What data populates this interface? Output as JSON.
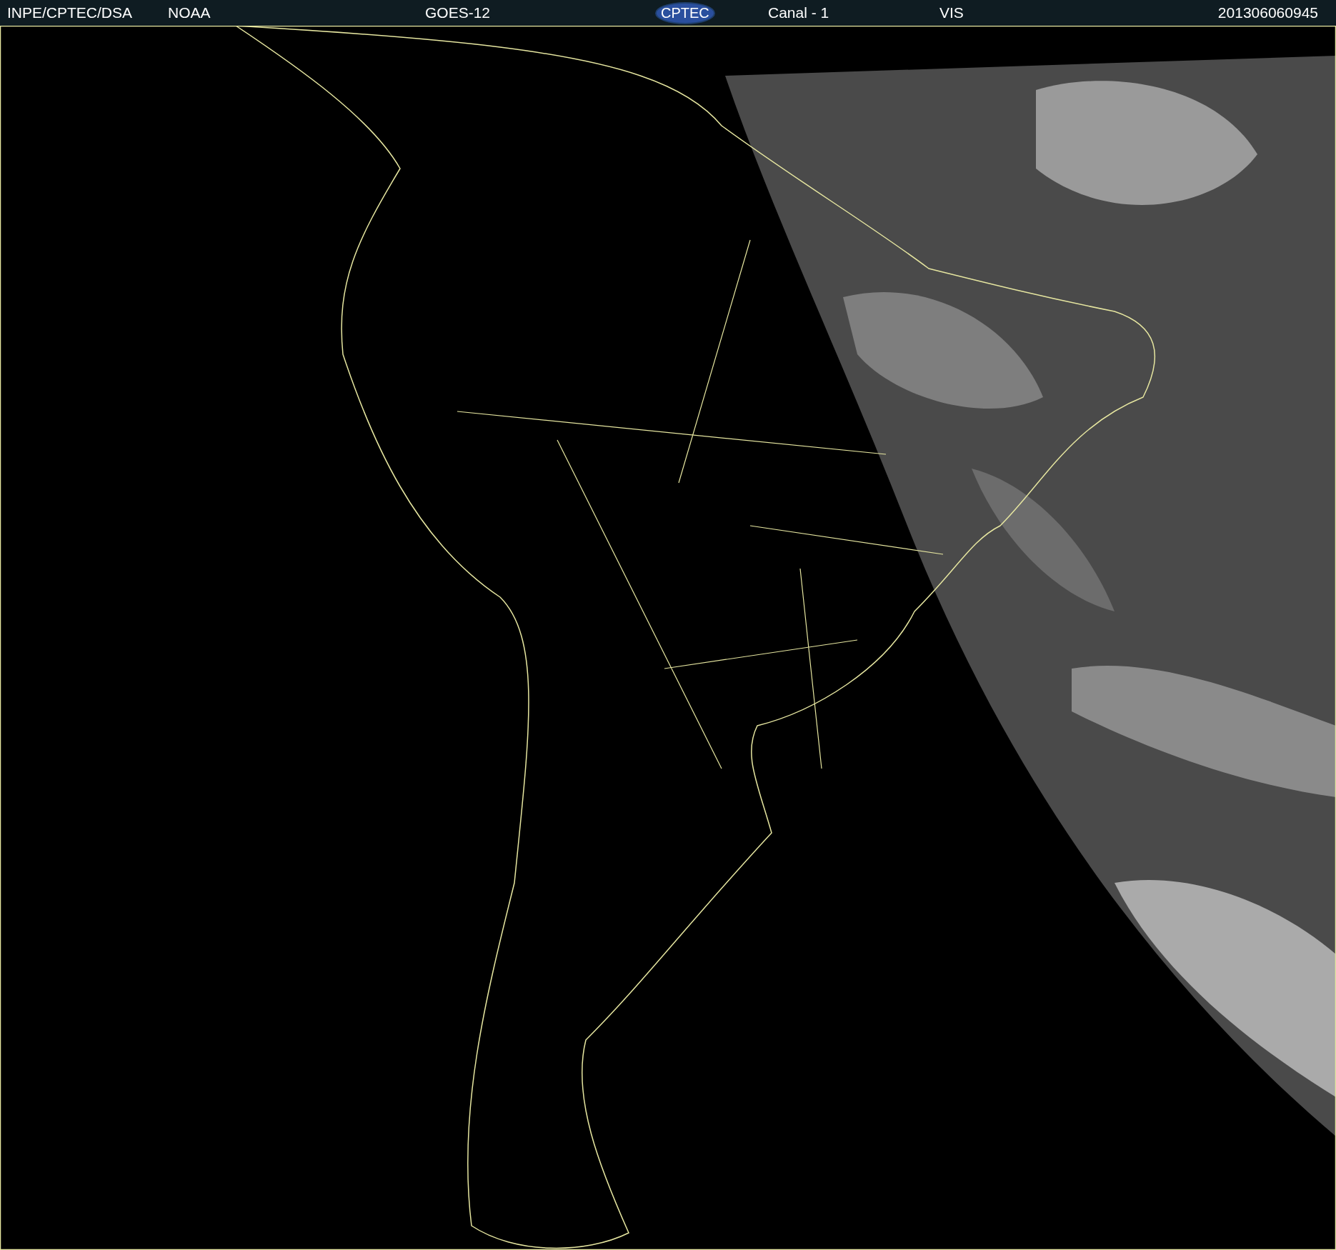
{
  "header": {
    "items": [
      {
        "kind": "text",
        "text": "INPE/CPTEC/DSA"
      },
      {
        "kind": "text",
        "text": "NOAA"
      },
      {
        "kind": "text",
        "text": "GOES-12"
      },
      {
        "kind": "logo",
        "text": "CPTEC"
      },
      {
        "kind": "text",
        "text": "Canal - 1"
      },
      {
        "kind": "text",
        "text": "VIS"
      },
      {
        "kind": "text",
        "text": "201306060945"
      }
    ]
  }
}
